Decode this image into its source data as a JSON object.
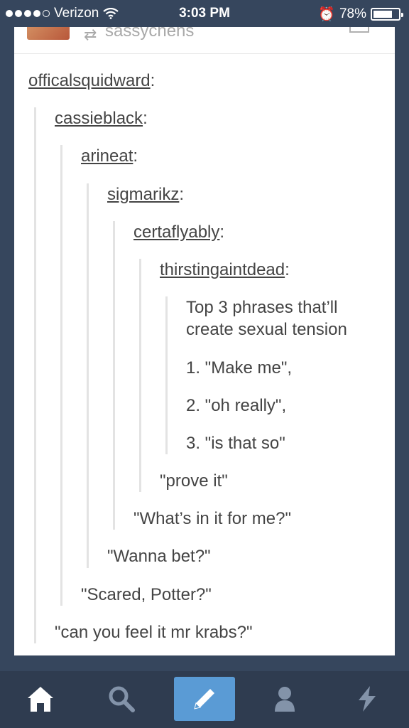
{
  "status": {
    "carrier": "Verizon",
    "time": "3:03 PM",
    "battery": "78%",
    "battery_level": 0.78,
    "signal_bars": 4
  },
  "post": {
    "reblogged_from": "sassychens",
    "trail": [
      {
        "user": "officalsquidward"
      },
      {
        "user": "cassieblack"
      },
      {
        "user": "arineat"
      },
      {
        "user": "sigmarikz"
      },
      {
        "user": "certaflyably"
      },
      {
        "user": "thirstingaintdead"
      }
    ],
    "original_text": "Top 3 phrases that’ll create sexual tension",
    "list": [
      "1. \"Make me\",",
      "2. \"oh really\",",
      "3. \"is that so\""
    ],
    "replies": [
      "\"prove it\"",
      "\"What’s in it for me?\"",
      "\"Wanna bet?\"",
      "\"Scared, Potter?\"",
      "\"can you feel it mr krabs?\""
    ]
  },
  "tabs": [
    {
      "name": "home-icon"
    },
    {
      "name": "search-icon"
    },
    {
      "name": "compose-icon"
    },
    {
      "name": "account-icon"
    },
    {
      "name": "activity-icon"
    }
  ],
  "colors": {
    "background": "#36465d",
    "compose_active": "#5a9bd5"
  }
}
